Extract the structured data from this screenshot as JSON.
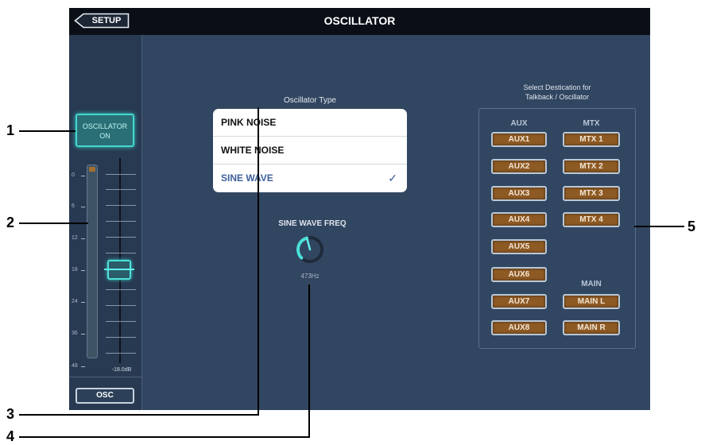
{
  "header": {
    "back_label": "SETUP",
    "title": "OSCILLATOR"
  },
  "sidebar": {
    "oscillator_on": {
      "line1": "OSCILLATOR",
      "line2": "ON"
    },
    "meter_scale": [
      "0",
      "6",
      "12",
      "18",
      "24",
      "36",
      "48"
    ],
    "fader_value": "-18.0dB",
    "tab_label": "OSC"
  },
  "oscillator_type": {
    "label": "Oscillator Type",
    "options": [
      "PINK NOISE",
      "WHITE NOISE",
      "SINE WAVE"
    ],
    "selected": "SINE WAVE",
    "check": "✓"
  },
  "sine_freq": {
    "label": "SINE WAVE FREQ",
    "value": "473Hz"
  },
  "destination": {
    "label_line1": "Select Destication for",
    "label_line2": "Talkback / Oscillator",
    "aux_header": "AUX",
    "mtx_header": "MTX",
    "main_header": "MAIN",
    "aux": [
      "AUX1",
      "AUX2",
      "AUX3",
      "AUX4",
      "AUX5",
      "AUX6",
      "AUX7",
      "AUX8"
    ],
    "mtx": [
      "MTX 1",
      "MTX 2",
      "MTX 3",
      "MTX 4"
    ],
    "main": [
      "MAIN L",
      "MAIN R"
    ]
  },
  "callouts": [
    "1",
    "2",
    "3",
    "4",
    "5"
  ],
  "colors": {
    "accent": "#45d6cf",
    "button_fill": "#8e5a24",
    "panel_bg": "#314661",
    "title_bg": "#0a0f17",
    "selected_text": "#3d5f9a"
  }
}
